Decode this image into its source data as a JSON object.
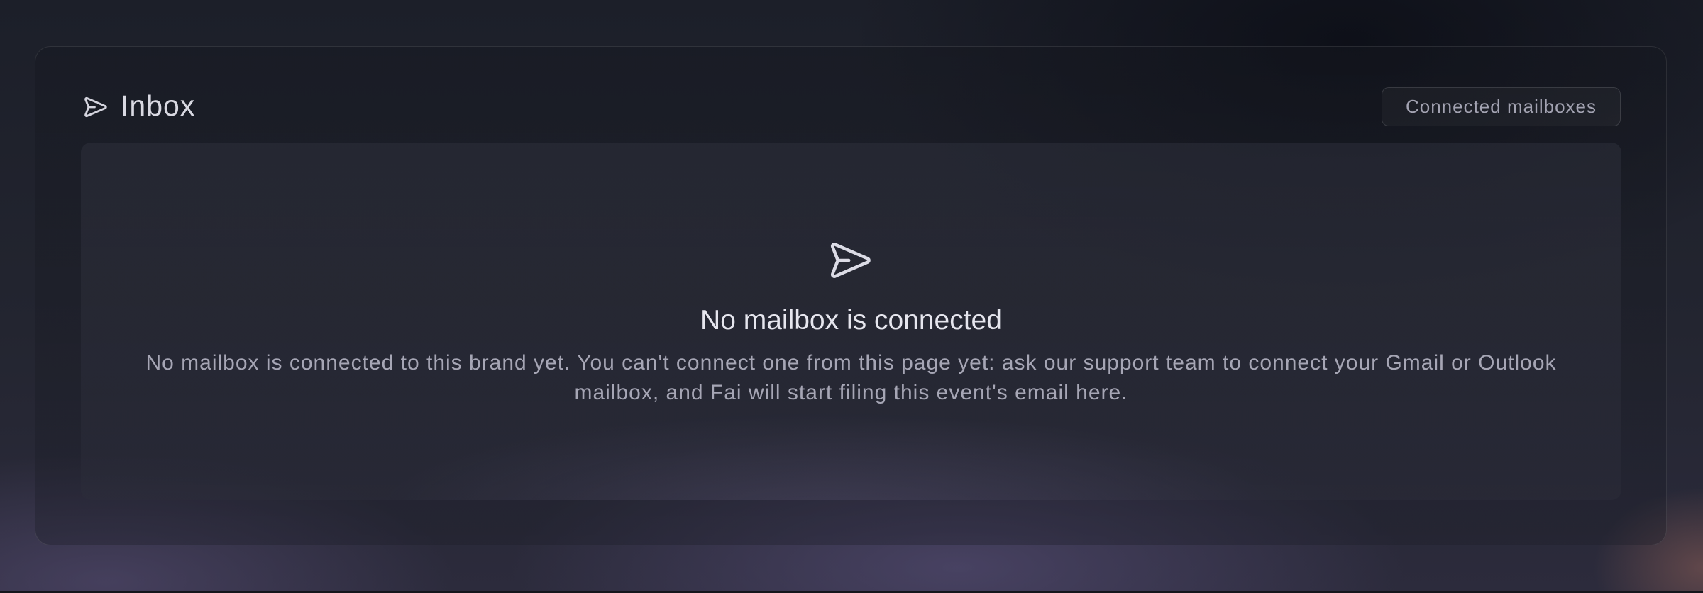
{
  "inbox": {
    "title": "Inbox",
    "header_icon": "send-icon",
    "connected_mailboxes_label": "Connected mailboxes"
  },
  "empty_state": {
    "icon": "send-icon",
    "title": "No mailbox is connected",
    "description": "No mailbox is connected to this brand yet. You can't connect one from this page yet: ask our support team to connect your Gmail or Outlook mailbox, and Fai will start filing this event's email here."
  },
  "colors": {
    "background": "#1f212b",
    "text_primary": "#e6e6ee",
    "text_secondary": "#a6a6b5"
  }
}
